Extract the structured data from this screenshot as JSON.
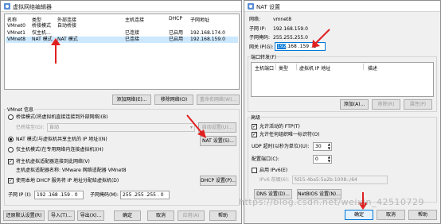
{
  "vnet_editor": {
    "title": "虚拟网络编辑器",
    "columns": [
      "名称",
      "类型",
      "外部连接",
      "主机连接",
      "DHCP",
      "子网地址"
    ],
    "rows": [
      {
        "name": "VMnet0",
        "type": "桥接模式",
        "external": "自动桥接",
        "host": "",
        "dhcp": "",
        "subnet": ""
      },
      {
        "name": "VMnet1",
        "type": "仅主机...",
        "external": "",
        "host": "已连接",
        "dhcp": "已启用",
        "subnet": "192.168.174.0"
      },
      {
        "name": "VMnet8",
        "type": "NAT 模式",
        "external": "NAT 模式",
        "host": "已连接",
        "dhcp": "已启用",
        "subnet": "192.168.159.0"
      }
    ],
    "add_network": "添加网络(E)...",
    "remove_network": "移除网络(O)",
    "rename_network": "重命名网络(W)...",
    "info_title": "VMnet 信息",
    "bridge_radio": "桥接模式(将虚拟机直接连接到外部网络)(B)",
    "bridged_to_label": "已桥接至(G):",
    "bridged_to_value": "自动",
    "auto_settings": "自动设置(U)...",
    "nat_radio": "NAT 模式(与虚拟机共享主机的 IP 地址)(N)",
    "nat_settings": "NAT 设置(S)...",
    "host_only_radio": "仅主机模式(在专用网络内连接虚拟机)(H)",
    "connect_adapter_chk": "将主机虚拟适配器连接到此网络(V)",
    "adapter_name_text": "主机虚拟适配器名称: VMware 网络适配器 VMnet8",
    "dhcp_chk": "使用本地 DHCP 服务将 IP 地址分配给虚拟机(D)",
    "dhcp_settings": "DHCP 设置(P)...",
    "subnet_ip_label": "子网 IP (I):",
    "subnet_ip_value": "192 .168 .159 . 0",
    "subnet_mask_label": "子网掩码(M):",
    "subnet_mask_value": "255 .255 .255 . 0",
    "restore_defaults": "还原默认设置(R)",
    "import": "导入(T)...",
    "export": "导出(X)...",
    "ok": "确定",
    "cancel": "取消",
    "apply": "应用(A)",
    "help": "帮助"
  },
  "nat_settings": {
    "title": "NAT 设置",
    "network_label": "网络:",
    "network_value": "vmnet8",
    "subnet_ip_label": "子网 IP:",
    "subnet_ip_value": "192.168.159.0",
    "subnet_mask_label": "子网掩码:",
    "subnet_mask_value": "255.255.255.0",
    "gateway_label": "网关 IP(G):",
    "gateway_octet1": "192",
    "gateway_rest": ".168 .159 . 2",
    "port_forward_title": "端口转发(F)",
    "pf_columns": [
      "主机端口",
      "类型",
      "虚拟机 IP 地址",
      "描述"
    ],
    "add": "添加(A)...",
    "remove": "移除(R)",
    "properties": "属性(P)",
    "advanced_title": "高级",
    "allow_ftp": "允许活动的 FTP(T)",
    "allow_any_oui": "允许任何组织唯一标识符(O)",
    "udp_timeout_label": "UDP 超时(以秒为单位)(U):",
    "udp_timeout_value": "30",
    "config_port_label": "配置端口(C):",
    "config_port_value": "0",
    "enable_ipv6": "启用 IPv6(E)",
    "ipv6_prefix_label": "IPv6 前缀(6):",
    "ipv6_prefix_value": "fd15:4ba5:5a2b:1008::/64",
    "dns_settings": "DNS 设置(D)...",
    "netbios_settings": "NetBIOS 设置(N)...",
    "ok": "确定",
    "cancel": "取消",
    "help": "帮助"
  },
  "watermark": "https://blog.csdn.net/weixin_42510729",
  "colors": {
    "accent": "#0078d7",
    "selection": "#cce8ff",
    "annotation_red": "#e02020"
  }
}
